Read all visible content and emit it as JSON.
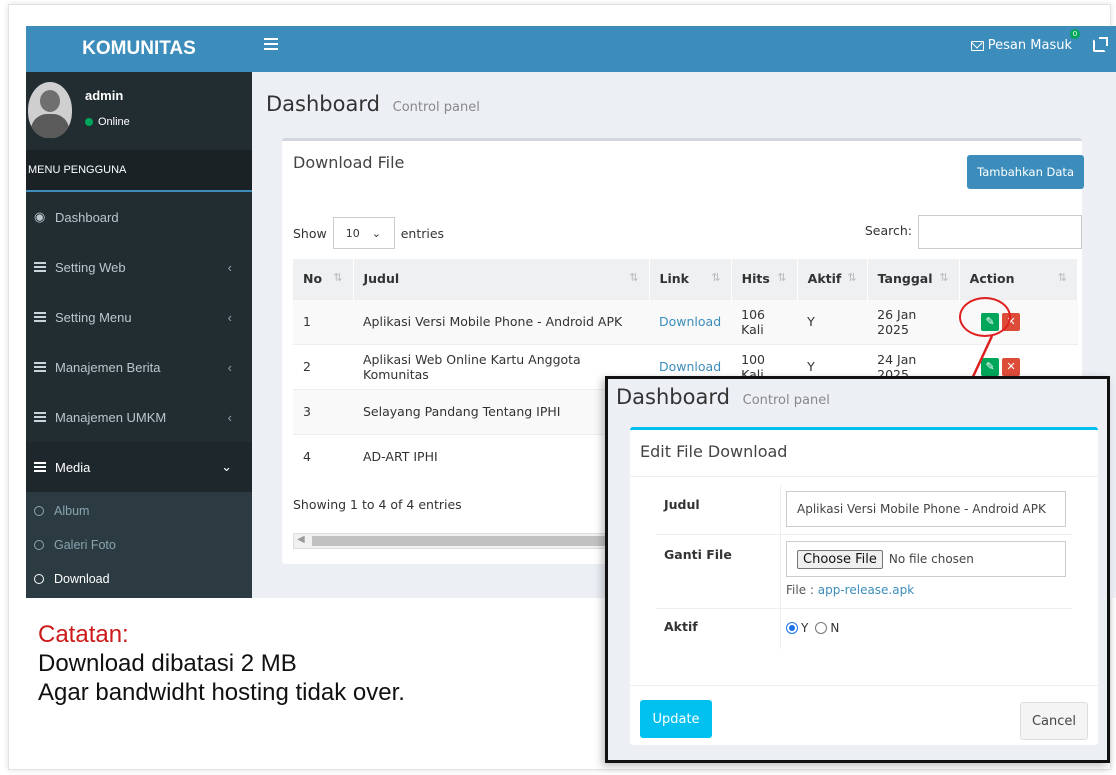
{
  "app": {
    "brand": "KOMUNITAS"
  },
  "topbar": {
    "inbox_label": "Pesan Masuk",
    "inbox_count": "0"
  },
  "user": {
    "name": "admin",
    "status": "Online"
  },
  "sidebar": {
    "header": "MENU PENGGUNA",
    "items": [
      {
        "label": "Dashboard"
      },
      {
        "label": "Setting Web"
      },
      {
        "label": "Setting Menu"
      },
      {
        "label": "Manajemen Berita"
      },
      {
        "label": "Manajemen UMKM"
      },
      {
        "label": "Media"
      }
    ],
    "submenu": [
      {
        "label": "Album"
      },
      {
        "label": "Galeri Foto"
      },
      {
        "label": "Download"
      }
    ]
  },
  "page": {
    "title": "Dashboard",
    "subtitle": "Control panel"
  },
  "box": {
    "title": "Download File",
    "add_button": "Tambahkan Data",
    "show_label": "Show",
    "entries_value": "10",
    "entries_label": "entries",
    "search_label": "Search:",
    "columns": [
      "No",
      "Judul",
      "Link",
      "Hits",
      "Aktif",
      "Tanggal",
      "Action"
    ],
    "rows": [
      {
        "no": "1",
        "judul": "Aplikasi Versi Mobile Phone - Android APK",
        "link": "Download",
        "hits": "106 Kali",
        "aktif": "Y",
        "tanggal": "26 Jan 2025"
      },
      {
        "no": "2",
        "judul": "Aplikasi Web Online Kartu Anggota Komunitas",
        "link": "Download",
        "hits": "100 Kali",
        "aktif": "Y",
        "tanggal": "24 Jan 2025"
      },
      {
        "no": "3",
        "judul": "Selayang Pandang Tentang IPHI",
        "link": "",
        "hits": "",
        "aktif": "",
        "tanggal": ""
      },
      {
        "no": "4",
        "judul": "AD-ART IPHI",
        "link": "",
        "hits": "",
        "aktif": "",
        "tanggal": ""
      }
    ],
    "showing": "Showing 1 to 4 of 4 entries"
  },
  "note": {
    "title": "Catatan:",
    "line1": "Download dibatasi 2 MB",
    "line2": "Agar bandwidht hosting tidak over."
  },
  "edit": {
    "page_title": "Dashboard",
    "page_subtitle": "Control panel",
    "box_title": "Edit File Download",
    "judul_label": "Judul",
    "judul_value": "Aplikasi Versi Mobile Phone - Android APK",
    "file_label": "Ganti File",
    "choose_button": "Choose File",
    "no_file": "No file chosen",
    "file_prefix": "File :",
    "file_name": "app-release.apk",
    "aktif_label": "Aktif",
    "opt_y": "Y",
    "opt_n": "N",
    "update_button": "Update",
    "cancel_button": "Cancel"
  },
  "colors": {
    "primary": "#3c8dbc",
    "sidebar": "#222d32",
    "success": "#00a65a",
    "danger": "#dd4b39",
    "info": "#00c0ef",
    "annotation": "#e02020"
  }
}
